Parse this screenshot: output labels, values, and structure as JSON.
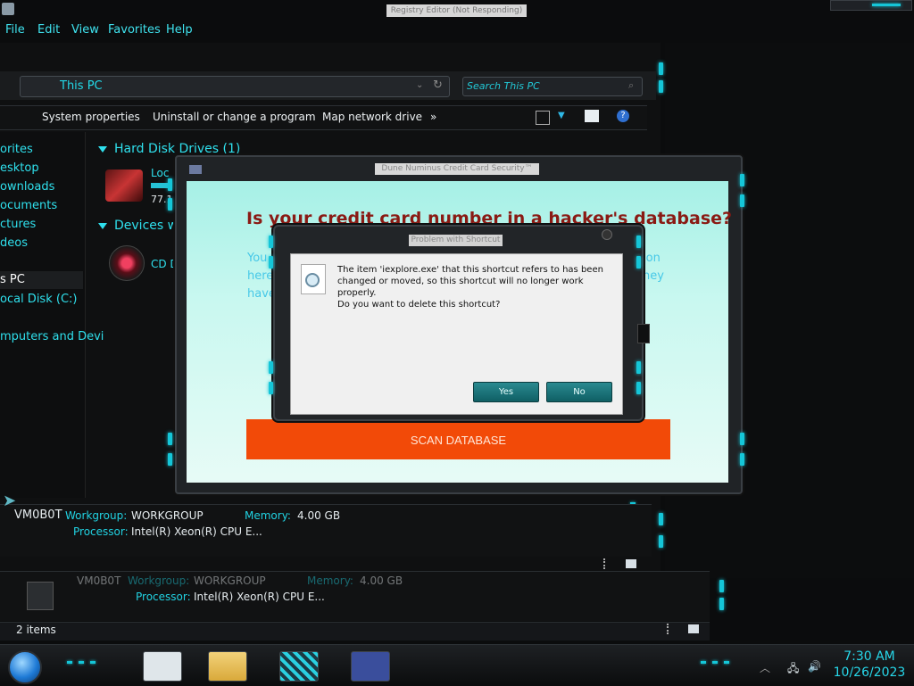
{
  "window": {
    "title": "Registry Editor (Not Responding)"
  },
  "menu": [
    "File",
    "Edit",
    "View",
    "Favorites",
    "Help"
  ],
  "explorer": {
    "address": "This PC",
    "search_placeholder": "Search This PC",
    "commands": [
      "System properties",
      "Uninstall or change a program",
      "Map network drive",
      "»"
    ],
    "nav": [
      "orites",
      "esktop",
      "ownloads",
      "ocuments",
      "ctures",
      "deos",
      "s PC",
      "ocal Disk (C:)",
      "mputers and Devi"
    ],
    "group_hdd": "Hard Disk Drives (1)",
    "drive_label": "Loc",
    "drive_size": "77.1",
    "group_devices": "Devices w",
    "cd_label": "CD D",
    "details": {
      "computer": "VM0B0T",
      "workgroup_label": "Workgroup:",
      "workgroup": "WORKGROUP",
      "memory_label": "Memory:",
      "memory": "4.00 GB",
      "processor_label": "Processor:",
      "processor": "Intel(R) Xeon(R) CPU E..."
    },
    "status": "2 items"
  },
  "scam_window": {
    "title": "Dune Numinus Credit Card Security™",
    "headline": "Is your credit card number in a hacker's database?",
    "faint_left": [
      "You",
      "here",
      "have"
    ],
    "faint_right": [
      "ion",
      "ney"
    ],
    "scan_button": "SCAN DATABASE"
  },
  "dialog": {
    "title": "Problem with Shortcut",
    "message": "The item 'iexplore.exe' that this shortcut refers to has been changed or moved, so this shortcut will no longer work properly.",
    "question": "Do you want to delete this shortcut?",
    "yes": "Yes",
    "no": "No"
  },
  "taskbar": {
    "time": "7:30 AM",
    "date": "10/26/2023"
  },
  "colors": {
    "accent": "#15c6d8",
    "scan_button": "#f24a08",
    "headline": "#8a1a14"
  }
}
